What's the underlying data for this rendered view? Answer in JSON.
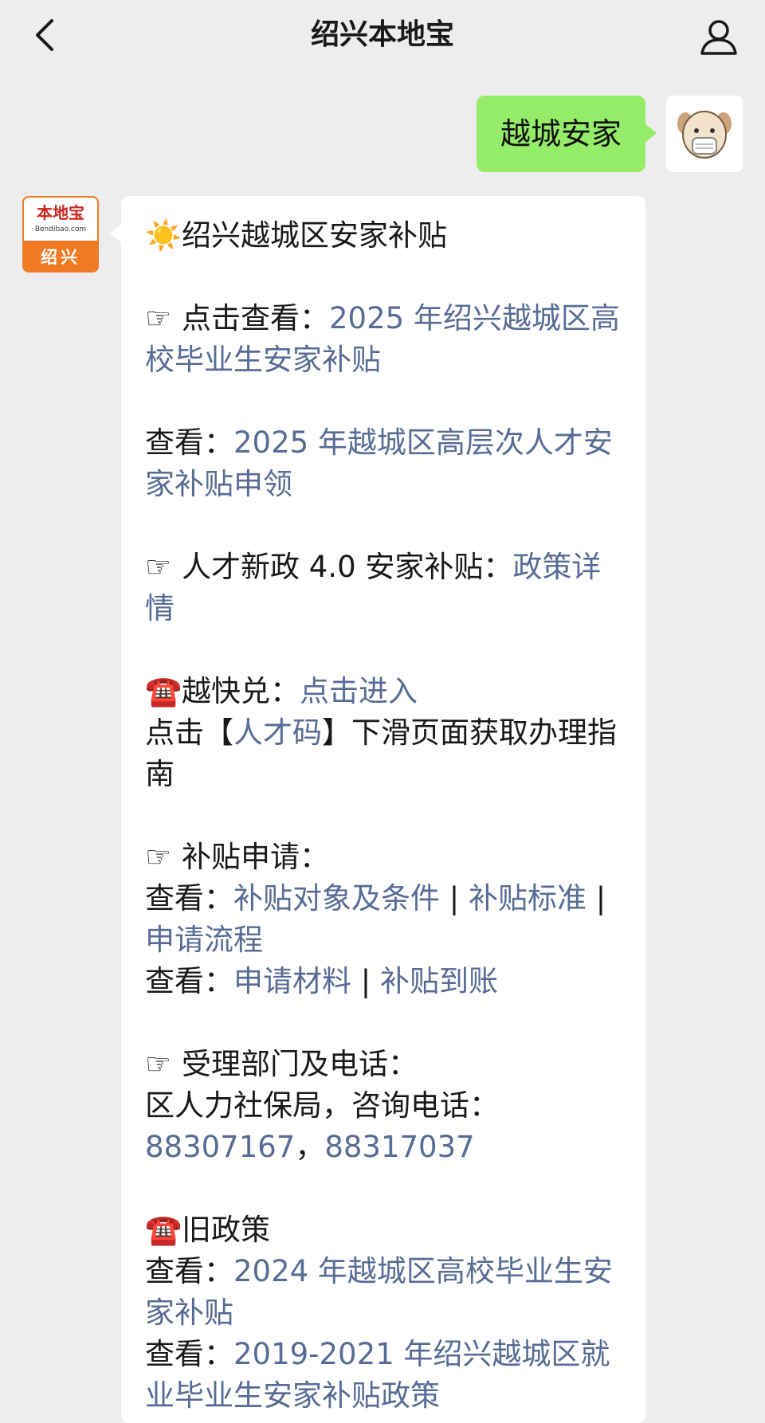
{
  "header": {
    "title": "绍兴本地宝"
  },
  "outgoing": {
    "text": "越城安家"
  },
  "bot_avatar": {
    "name": "本地宝",
    "url": "Bendibao.com",
    "city": "绍兴"
  },
  "message": {
    "heading": "绍兴越城区安家补贴",
    "s1_prefix": "点击查看：",
    "s1_link": "2025 年绍兴越城区高校毕业生安家补贴",
    "s2_prefix": "查看：",
    "s2_link": "2025 年越城区高层次人才安家补贴申领",
    "s3_prefix": "人才新政 4.0 安家补贴：",
    "s3_link": "政策详情",
    "s4_prefix": "越快兑：",
    "s4_link": "点击进入",
    "s4_line2_a": "点击【",
    "s4_line2_link": "人才码",
    "s4_line2_b": "】下滑页面获取办理指南",
    "s5_title": "补贴申请：",
    "s5_prefix1": "查看：",
    "s5_link1": "补贴对象及条件",
    "sep": " | ",
    "s5_link2": "补贴标准",
    "s5_link3": "申请流程",
    "s5_prefix2": "查看：",
    "s5_link4": "申请材料",
    "s5_link5": "补贴到账",
    "s6_title": "受理部门及电话：",
    "s6_line": "区人力社保局，咨询电话：",
    "s6_phone1": "88307167",
    "s6_comma": "，",
    "s6_phone2": "88317037",
    "s7_title": "旧政策",
    "s7_prefix1": "查看：",
    "s7_link1": "2024 年越城区高校毕业生安家补贴",
    "s7_prefix2": "查看：",
    "s7_link2": "2019-2021 年绍兴越城区就业毕业生安家补贴政策"
  },
  "icons": {
    "sun": "☀️",
    "hand": "☞",
    "phone": "☎️"
  },
  "colors": {
    "link": "#576b95",
    "outgoing_bubble": "#95ec69",
    "brand_orange": "#f07a22"
  }
}
